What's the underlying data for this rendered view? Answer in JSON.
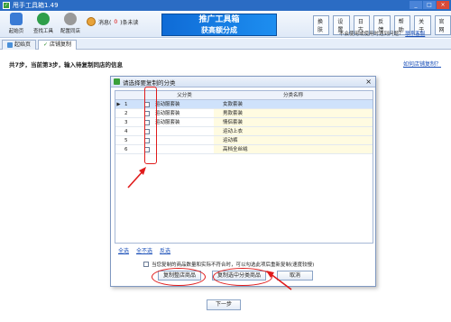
{
  "window": {
    "title": "甩手工具箱1.49",
    "controls": [
      "_",
      "□",
      "×"
    ]
  },
  "toolbar": {
    "tools": [
      {
        "label": "起始页",
        "icon": "home-icon",
        "color": "#3a7bd5"
      },
      {
        "label": "查找工具",
        "icon": "search-icon",
        "color": "#2e9e4a"
      },
      {
        "label": "配置同店",
        "icon": "gear-icon",
        "color": "#888888"
      }
    ],
    "message_prefix": "消息(",
    "message_count": "0",
    "message_suffix": ")条未读",
    "banner_line1": "推广工具箱",
    "banner_line2": "获高额分成",
    "right_buttons": [
      "换肤",
      "设置",
      "日志",
      "反馈",
      "帮助",
      "关于",
      "官网"
    ],
    "notice": "不会使用或使用时遇到问题？",
    "notice_link": "联系客服"
  },
  "tabs": [
    {
      "label": "起始页",
      "active": false
    },
    {
      "label": "店铺复制",
      "active": true
    }
  ],
  "main": {
    "steps_text": "共7步，当前第3步，输入待复制同店的信息",
    "help_link": "如何店铺复制？",
    "next_button": "下一步"
  },
  "dialog": {
    "title": "请选择要复制的分类",
    "close": "×",
    "columns": {
      "parent": "父分类",
      "name": "分类名称"
    },
    "rows": [
      {
        "no": "1",
        "parent": "运动服套装",
        "name": "女款套装",
        "selected": true
      },
      {
        "no": "2",
        "parent": "运动服套装",
        "name": "男款套装",
        "selected": false
      },
      {
        "no": "3",
        "parent": "运动服套装",
        "name": "情侣套装",
        "selected": false
      },
      {
        "no": "4",
        "parent": "",
        "name": "运动上衣",
        "selected": false
      },
      {
        "no": "5",
        "parent": "",
        "name": "运动裤",
        "selected": false
      },
      {
        "no": "6",
        "parent": "",
        "name": "高档全丝绒",
        "selected": false
      }
    ],
    "select_links": [
      "全选",
      "全不选",
      "反选"
    ],
    "checkbox_label": "当您复制的商品数量和实际不符合时，可以勾选此项后重新复制(速度较慢)",
    "buttons": [
      "复制整店商品",
      "复制选中分类商品",
      "取消"
    ]
  },
  "colors": {
    "accent": "#2b6cc4",
    "annotation_red": "#e01b1b",
    "banner": "#1d8ef0"
  }
}
